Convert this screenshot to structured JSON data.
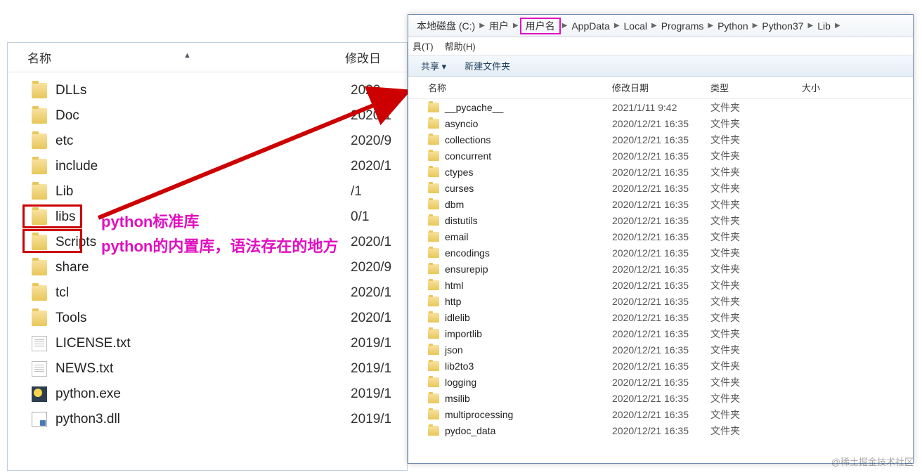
{
  "left": {
    "headers": {
      "name": "名称",
      "date": "修改日"
    },
    "rows": [
      {
        "name": "DLLs",
        "date": "2020",
        "icon": "folder"
      },
      {
        "name": "Doc",
        "date": "2020/1",
        "icon": "folder"
      },
      {
        "name": "etc",
        "date": "2020/9",
        "icon": "folder"
      },
      {
        "name": "include",
        "date": "2020/1",
        "icon": "folder"
      },
      {
        "name": "Lib",
        "date": "/1",
        "icon": "folder"
      },
      {
        "name": "libs",
        "date": "0/1",
        "icon": "folder"
      },
      {
        "name": "Scripts",
        "date": "2020/1",
        "icon": "folder"
      },
      {
        "name": "share",
        "date": "2020/9",
        "icon": "folder"
      },
      {
        "name": "tcl",
        "date": "2020/1",
        "icon": "folder"
      },
      {
        "name": "Tools",
        "date": "2020/1",
        "icon": "folder"
      },
      {
        "name": "LICENSE.txt",
        "date": "2019/1",
        "icon": "txt"
      },
      {
        "name": "NEWS.txt",
        "date": "2019/1",
        "icon": "txt"
      },
      {
        "name": "python.exe",
        "date": "2019/1",
        "icon": "exe"
      },
      {
        "name": "python3.dll",
        "date": "2019/1",
        "icon": "dll"
      }
    ]
  },
  "annotations": {
    "lib": "python标准库",
    "libs": "python的内置库，语法存在的地方"
  },
  "right": {
    "breadcrumb": [
      "本地磁盘 (C:)",
      "用户",
      "用户名",
      "AppData",
      "Local",
      "Programs",
      "Python",
      "Python37",
      "Lib"
    ],
    "breadcrumb_highlight_index": 2,
    "menu": [
      "具(T)",
      "帮助(H)"
    ],
    "toolbar": [
      "共享 ▾",
      "新建文件夹"
    ],
    "headers": {
      "name": "名称",
      "date": "修改日期",
      "type": "类型",
      "size": "大小"
    },
    "rows": [
      {
        "name": "__pycache__",
        "date": "2021/1/11 9:42",
        "type": "文件夹"
      },
      {
        "name": "asyncio",
        "date": "2020/12/21 16:35",
        "type": "文件夹"
      },
      {
        "name": "collections",
        "date": "2020/12/21 16:35",
        "type": "文件夹"
      },
      {
        "name": "concurrent",
        "date": "2020/12/21 16:35",
        "type": "文件夹"
      },
      {
        "name": "ctypes",
        "date": "2020/12/21 16:35",
        "type": "文件夹"
      },
      {
        "name": "curses",
        "date": "2020/12/21 16:35",
        "type": "文件夹"
      },
      {
        "name": "dbm",
        "date": "2020/12/21 16:35",
        "type": "文件夹"
      },
      {
        "name": "distutils",
        "date": "2020/12/21 16:35",
        "type": "文件夹"
      },
      {
        "name": "email",
        "date": "2020/12/21 16:35",
        "type": "文件夹"
      },
      {
        "name": "encodings",
        "date": "2020/12/21 16:35",
        "type": "文件夹"
      },
      {
        "name": "ensurepip",
        "date": "2020/12/21 16:35",
        "type": "文件夹"
      },
      {
        "name": "html",
        "date": "2020/12/21 16:35",
        "type": "文件夹"
      },
      {
        "name": "http",
        "date": "2020/12/21 16:35",
        "type": "文件夹"
      },
      {
        "name": "idlelib",
        "date": "2020/12/21 16:35",
        "type": "文件夹"
      },
      {
        "name": "importlib",
        "date": "2020/12/21 16:35",
        "type": "文件夹"
      },
      {
        "name": "json",
        "date": "2020/12/21 16:35",
        "type": "文件夹"
      },
      {
        "name": "lib2to3",
        "date": "2020/12/21 16:35",
        "type": "文件夹"
      },
      {
        "name": "logging",
        "date": "2020/12/21 16:35",
        "type": "文件夹"
      },
      {
        "name": "msilib",
        "date": "2020/12/21 16:35",
        "type": "文件夹"
      },
      {
        "name": "multiprocessing",
        "date": "2020/12/21 16:35",
        "type": "文件夹"
      },
      {
        "name": "pydoc_data",
        "date": "2020/12/21 16:35",
        "type": "文件夹"
      }
    ]
  },
  "watermark": "@稀土掘金技术社区"
}
